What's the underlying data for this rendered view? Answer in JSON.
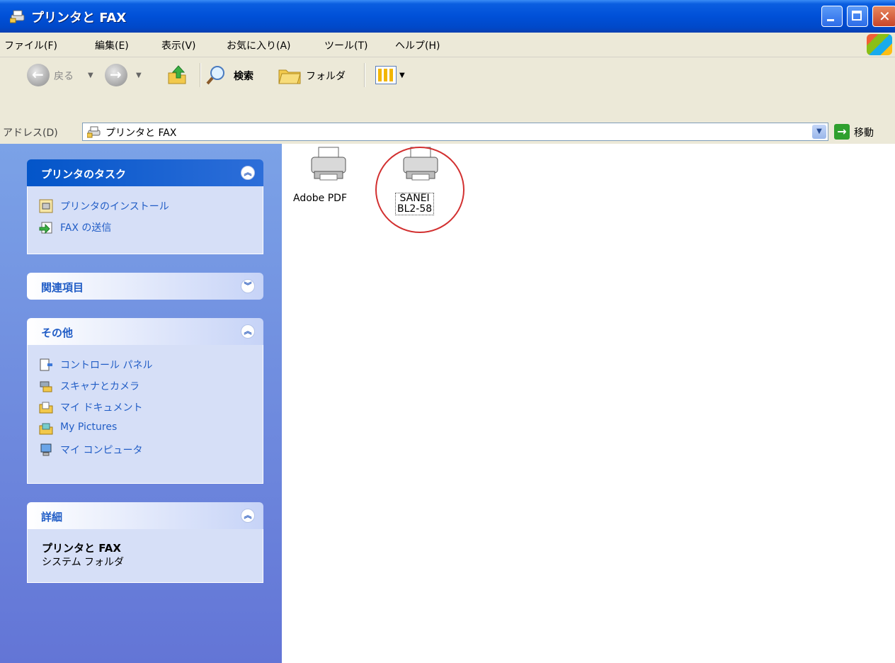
{
  "window": {
    "title": "プリンタと FAX"
  },
  "menu": {
    "items": [
      "ファイル(F)",
      "編集(E)",
      "表示(V)",
      "お気に入り(A)",
      "ツール(T)",
      "ヘルプ(H)"
    ]
  },
  "toolbar": {
    "back_label": "戻る",
    "search_label": "検索",
    "folders_label": "フォルダ"
  },
  "address": {
    "label": "アドレス(D)",
    "value": "プリンタと FAX",
    "go_label": "移動"
  },
  "taskpane": {
    "printer_tasks": {
      "title": "プリンタのタスク",
      "items": [
        {
          "label": "プリンタのインストール",
          "icon": "add-printer-icon"
        },
        {
          "label": "FAX の送信",
          "icon": "send-fax-icon"
        }
      ]
    },
    "related": {
      "title": "関連項目"
    },
    "other": {
      "title": "その他",
      "items": [
        {
          "label": "コントロール パネル",
          "icon": "control-panel-icon"
        },
        {
          "label": "スキャナとカメラ",
          "icon": "scanner-camera-icon"
        },
        {
          "label": "マイ ドキュメント",
          "icon": "my-documents-icon"
        },
        {
          "label": "My Pictures",
          "icon": "my-pictures-icon"
        },
        {
          "label": "マイ コンピュータ",
          "icon": "my-computer-icon"
        }
      ]
    },
    "details": {
      "title": "詳細",
      "name": "プリンタと FAX",
      "type": "システム フォルダ"
    }
  },
  "printers": [
    {
      "label": "Adobe PDF",
      "selected": false
    },
    {
      "label_line1": "SANEI",
      "label_line2": "BL2-58",
      "selected": true
    }
  ],
  "colors": {
    "titlebar": "#0050d8",
    "taskpane": "#6f8de0",
    "link": "#215dc6",
    "highlight_circle": "#d23030"
  }
}
